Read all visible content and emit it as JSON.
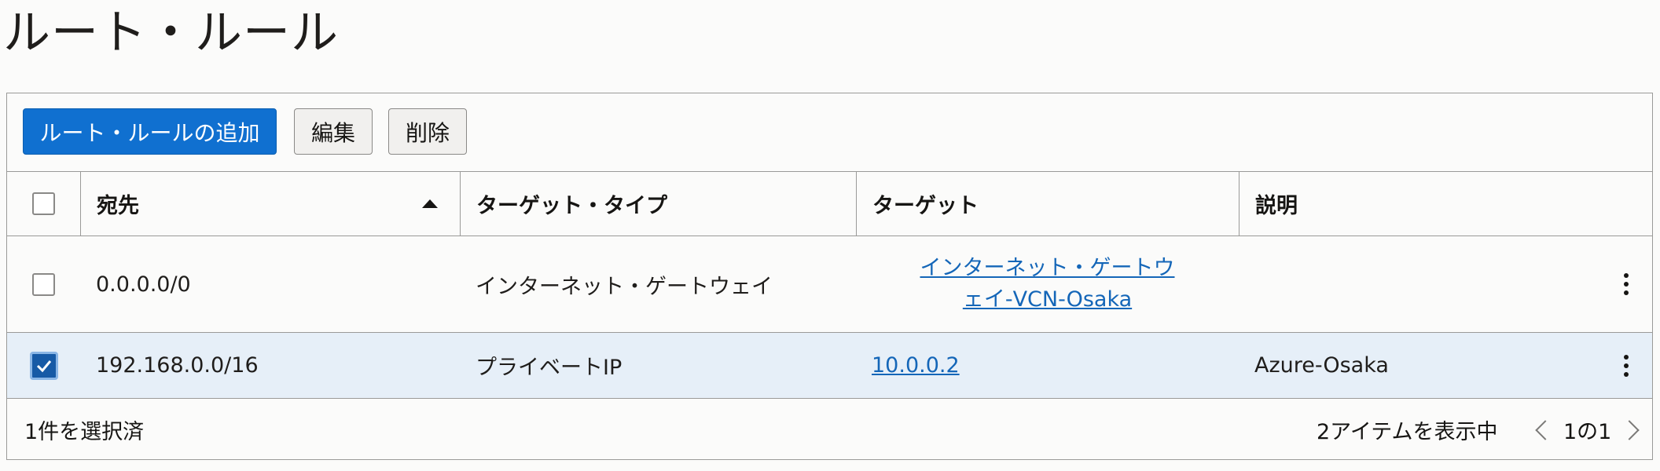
{
  "page": {
    "title": "ルート・ルール"
  },
  "toolbar": {
    "add_label": "ルート・ルールの追加",
    "edit_label": "編集",
    "delete_label": "削除"
  },
  "table": {
    "headers": {
      "destination": "宛先",
      "target_type": "ターゲット・タイプ",
      "target": "ターゲット",
      "description": "説明"
    },
    "sort": {
      "column": "destination",
      "direction": "ascending"
    },
    "rows": [
      {
        "selected": false,
        "destination": "0.0.0.0/0",
        "target_type": "インターネット・ゲートウェイ",
        "target": "インターネット・ゲートウェイ-VCN-Osaka",
        "description": ""
      },
      {
        "selected": true,
        "destination": "192.168.0.0/16",
        "target_type": "プライベートIP",
        "target": "10.0.0.2",
        "description": "Azure-Osaka"
      }
    ]
  },
  "footer": {
    "selected_text": "1件を選択済",
    "count_text": "2アイテムを表示中",
    "page_text": "1の1"
  },
  "colors": {
    "primary": "#1070d0",
    "link": "#1466b8",
    "selected_row": "#e6eff8",
    "checkbox_checked": "#175aa6"
  }
}
